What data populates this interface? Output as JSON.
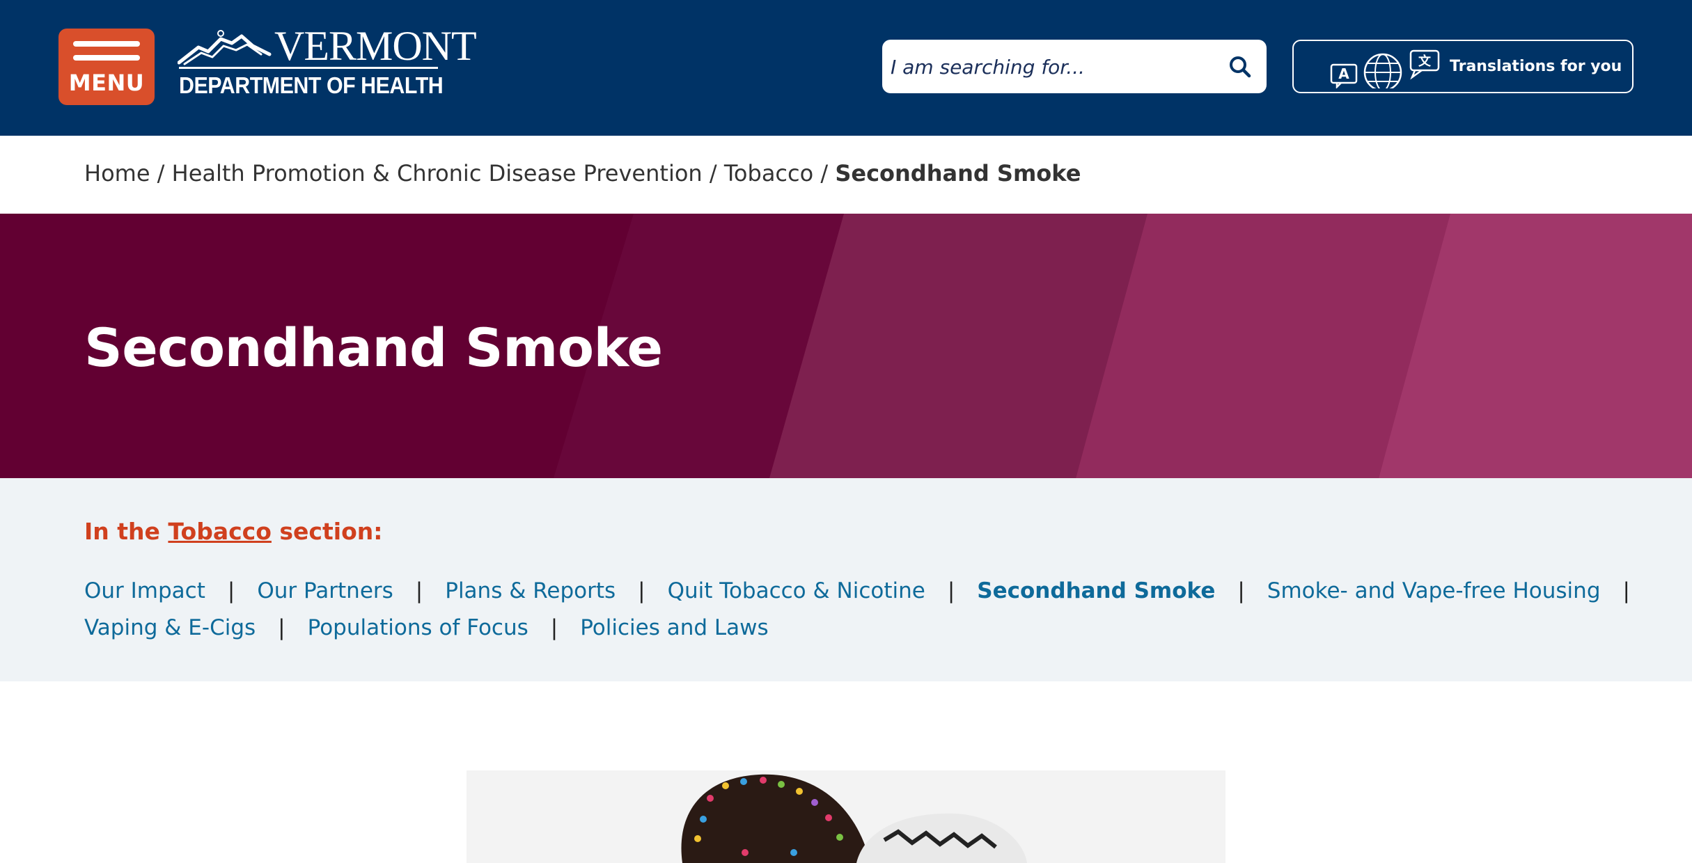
{
  "header": {
    "menu_label": "MENU",
    "logo_vermont": "VERMONT",
    "logo_department": "DEPARTMENT OF HEALTH",
    "search_placeholder": "I am searching for...",
    "translate_label": "Translations for you"
  },
  "breadcrumb": {
    "items": [
      "Home",
      "Health Promotion & Chronic Disease Prevention",
      "Tobacco"
    ],
    "separator": "/",
    "current": "Secondhand Smoke"
  },
  "hero": {
    "title": "Secondhand Smoke"
  },
  "section_nav": {
    "heading_prefix": "In the",
    "heading_link": "Tobacco",
    "heading_suffix": "section:",
    "separator": "|",
    "row1": [
      "Our Impact",
      "Our Partners",
      "Plans & Reports",
      "Quit Tobacco & Nicotine",
      "Secondhand Smoke",
      "Smoke- and Vape-free Housing"
    ],
    "row2": [
      "Vaping & E-Cigs",
      "Populations of Focus",
      "Policies and Laws"
    ],
    "active": "Secondhand Smoke"
  },
  "colors": {
    "header_bg": "#003366",
    "menu_button": "#d94f2b",
    "hero_base": "#620032",
    "section_bg": "#eff3f6",
    "link": "#0e6a9a",
    "heading_accent": "#d0401e"
  },
  "icons": {
    "menu": "hamburger-icon",
    "search": "search-icon",
    "translate": [
      "translate-a-icon",
      "globe-icon",
      "translate-chat-icon"
    ],
    "logo": "mountain-logo-icon"
  }
}
